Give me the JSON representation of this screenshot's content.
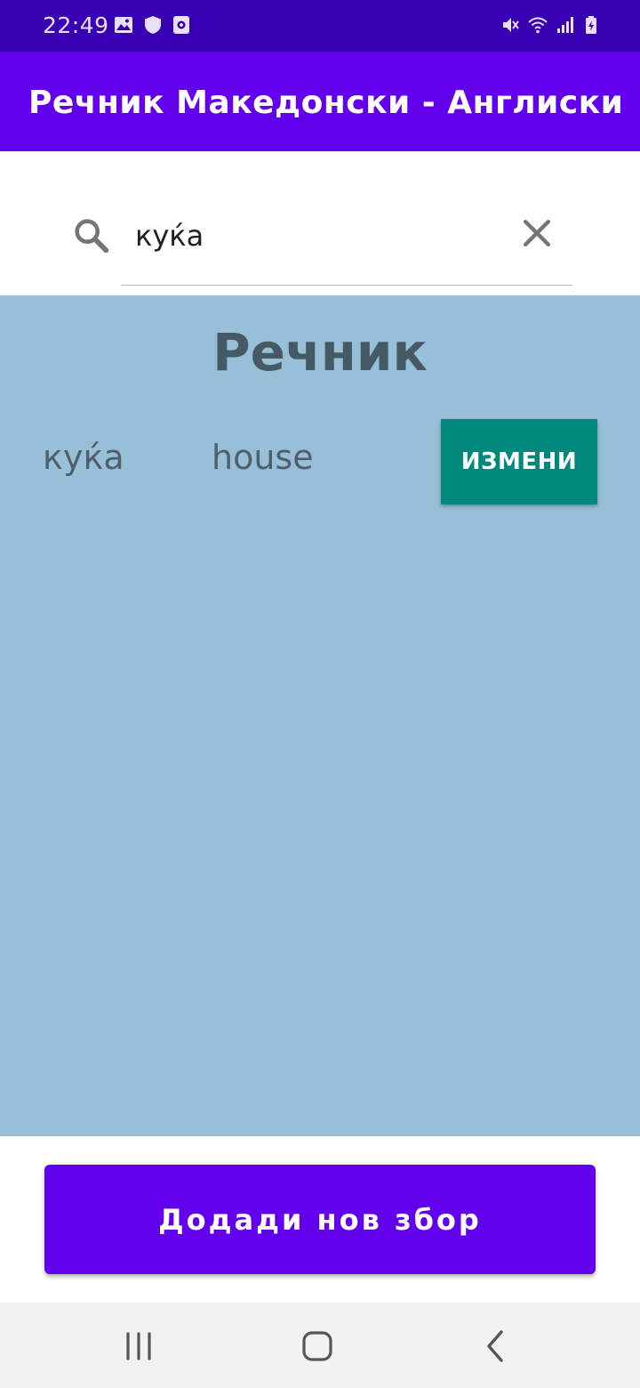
{
  "status_bar": {
    "time": "22:49",
    "left_icons": [
      "image-icon",
      "shield-icon",
      "screen-record-icon"
    ],
    "right_icons": [
      "mute-icon",
      "wifi-icon",
      "signal-icon",
      "battery-charging-icon"
    ]
  },
  "app_bar": {
    "title": "Речник Македонски - Англиски",
    "color": "#6200ee"
  },
  "search": {
    "value": "куќа",
    "icon": "search-icon",
    "clear_icon": "close-icon"
  },
  "dictionary": {
    "title": "Речник",
    "background": "#98bfd8",
    "entries": [
      {
        "macedonian": "куќа",
        "english": "house",
        "edit_label": "ИЗМЕНИ"
      }
    ]
  },
  "actions": {
    "add_word_label": "Додади нов збор"
  },
  "nav_bar": {
    "icons": [
      "recent-apps-icon",
      "home-icon",
      "back-icon"
    ]
  },
  "colors": {
    "status_bar": "#3700b3",
    "accent": "#6200ee",
    "edit_button": "#00897b"
  }
}
